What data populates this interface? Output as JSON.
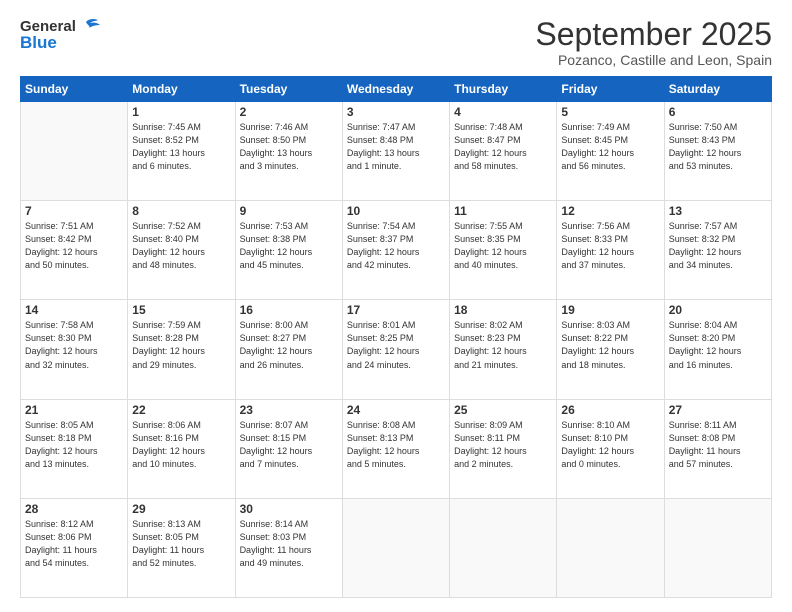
{
  "header": {
    "logo_line1": "General",
    "logo_line2": "Blue",
    "month_title": "September 2025",
    "location": "Pozanco, Castille and Leon, Spain"
  },
  "weekdays": [
    "Sunday",
    "Monday",
    "Tuesday",
    "Wednesday",
    "Thursday",
    "Friday",
    "Saturday"
  ],
  "weeks": [
    [
      {
        "day": "",
        "info": ""
      },
      {
        "day": "1",
        "info": "Sunrise: 7:45 AM\nSunset: 8:52 PM\nDaylight: 13 hours\nand 6 minutes."
      },
      {
        "day": "2",
        "info": "Sunrise: 7:46 AM\nSunset: 8:50 PM\nDaylight: 13 hours\nand 3 minutes."
      },
      {
        "day": "3",
        "info": "Sunrise: 7:47 AM\nSunset: 8:48 PM\nDaylight: 13 hours\nand 1 minute."
      },
      {
        "day": "4",
        "info": "Sunrise: 7:48 AM\nSunset: 8:47 PM\nDaylight: 12 hours\nand 58 minutes."
      },
      {
        "day": "5",
        "info": "Sunrise: 7:49 AM\nSunset: 8:45 PM\nDaylight: 12 hours\nand 56 minutes."
      },
      {
        "day": "6",
        "info": "Sunrise: 7:50 AM\nSunset: 8:43 PM\nDaylight: 12 hours\nand 53 minutes."
      }
    ],
    [
      {
        "day": "7",
        "info": "Sunrise: 7:51 AM\nSunset: 8:42 PM\nDaylight: 12 hours\nand 50 minutes."
      },
      {
        "day": "8",
        "info": "Sunrise: 7:52 AM\nSunset: 8:40 PM\nDaylight: 12 hours\nand 48 minutes."
      },
      {
        "day": "9",
        "info": "Sunrise: 7:53 AM\nSunset: 8:38 PM\nDaylight: 12 hours\nand 45 minutes."
      },
      {
        "day": "10",
        "info": "Sunrise: 7:54 AM\nSunset: 8:37 PM\nDaylight: 12 hours\nand 42 minutes."
      },
      {
        "day": "11",
        "info": "Sunrise: 7:55 AM\nSunset: 8:35 PM\nDaylight: 12 hours\nand 40 minutes."
      },
      {
        "day": "12",
        "info": "Sunrise: 7:56 AM\nSunset: 8:33 PM\nDaylight: 12 hours\nand 37 minutes."
      },
      {
        "day": "13",
        "info": "Sunrise: 7:57 AM\nSunset: 8:32 PM\nDaylight: 12 hours\nand 34 minutes."
      }
    ],
    [
      {
        "day": "14",
        "info": "Sunrise: 7:58 AM\nSunset: 8:30 PM\nDaylight: 12 hours\nand 32 minutes."
      },
      {
        "day": "15",
        "info": "Sunrise: 7:59 AM\nSunset: 8:28 PM\nDaylight: 12 hours\nand 29 minutes."
      },
      {
        "day": "16",
        "info": "Sunrise: 8:00 AM\nSunset: 8:27 PM\nDaylight: 12 hours\nand 26 minutes."
      },
      {
        "day": "17",
        "info": "Sunrise: 8:01 AM\nSunset: 8:25 PM\nDaylight: 12 hours\nand 24 minutes."
      },
      {
        "day": "18",
        "info": "Sunrise: 8:02 AM\nSunset: 8:23 PM\nDaylight: 12 hours\nand 21 minutes."
      },
      {
        "day": "19",
        "info": "Sunrise: 8:03 AM\nSunset: 8:22 PM\nDaylight: 12 hours\nand 18 minutes."
      },
      {
        "day": "20",
        "info": "Sunrise: 8:04 AM\nSunset: 8:20 PM\nDaylight: 12 hours\nand 16 minutes."
      }
    ],
    [
      {
        "day": "21",
        "info": "Sunrise: 8:05 AM\nSunset: 8:18 PM\nDaylight: 12 hours\nand 13 minutes."
      },
      {
        "day": "22",
        "info": "Sunrise: 8:06 AM\nSunset: 8:16 PM\nDaylight: 12 hours\nand 10 minutes."
      },
      {
        "day": "23",
        "info": "Sunrise: 8:07 AM\nSunset: 8:15 PM\nDaylight: 12 hours\nand 7 minutes."
      },
      {
        "day": "24",
        "info": "Sunrise: 8:08 AM\nSunset: 8:13 PM\nDaylight: 12 hours\nand 5 minutes."
      },
      {
        "day": "25",
        "info": "Sunrise: 8:09 AM\nSunset: 8:11 PM\nDaylight: 12 hours\nand 2 minutes."
      },
      {
        "day": "26",
        "info": "Sunrise: 8:10 AM\nSunset: 8:10 PM\nDaylight: 12 hours\nand 0 minutes."
      },
      {
        "day": "27",
        "info": "Sunrise: 8:11 AM\nSunset: 8:08 PM\nDaylight: 11 hours\nand 57 minutes."
      }
    ],
    [
      {
        "day": "28",
        "info": "Sunrise: 8:12 AM\nSunset: 8:06 PM\nDaylight: 11 hours\nand 54 minutes."
      },
      {
        "day": "29",
        "info": "Sunrise: 8:13 AM\nSunset: 8:05 PM\nDaylight: 11 hours\nand 52 minutes."
      },
      {
        "day": "30",
        "info": "Sunrise: 8:14 AM\nSunset: 8:03 PM\nDaylight: 11 hours\nand 49 minutes."
      },
      {
        "day": "",
        "info": ""
      },
      {
        "day": "",
        "info": ""
      },
      {
        "day": "",
        "info": ""
      },
      {
        "day": "",
        "info": ""
      }
    ]
  ]
}
